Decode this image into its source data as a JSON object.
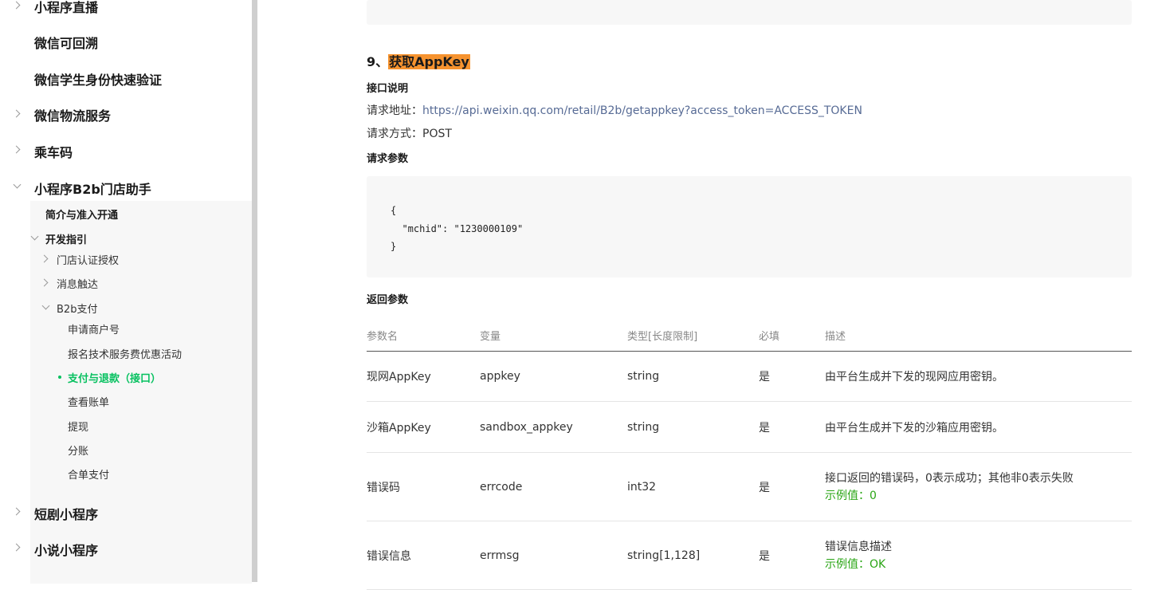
{
  "sidebar": {
    "top_items": [
      {
        "label": "小程序直播",
        "chevron": "right"
      },
      {
        "label": "微信可回溯",
        "chevron": ""
      },
      {
        "label": "微信学生身份快速验证",
        "chevron": ""
      },
      {
        "label": "微信物流服务",
        "chevron": "right"
      },
      {
        "label": "乘车码",
        "chevron": "right"
      },
      {
        "label": "小程序B2b门店助手",
        "chevron": "down"
      }
    ],
    "sub_intro": "简介与准入开通",
    "sub_dev": "开发指引",
    "dev_items": [
      "门店认证授权",
      "消息触达",
      "B2b支付"
    ],
    "pay_items": [
      "申请商户号",
      "报名技术服务费优惠活动",
      "支付与退款（接口）",
      "查看账单",
      "提现",
      "分账",
      "合单支付"
    ],
    "bottom_items": [
      {
        "label": "短剧小程序"
      },
      {
        "label": "小说小程序"
      }
    ],
    "accent_color": "#07c160"
  },
  "main": {
    "section_num": "9、",
    "section_title": "获取AppKey",
    "intro_heading": "接口说明",
    "req_url_label": "请求地址：",
    "req_url": "https://api.weixin.qq.com/retail/B2b/getappkey?access_token=ACCESS_TOKEN",
    "req_method_label": "请求方式：",
    "req_method": "POST",
    "req_params_heading": "请求参数",
    "code_sample": "{\n  \"mchid\": \"1230000109\"\n}",
    "resp_params_heading": "返回参数",
    "table": {
      "headers": [
        "参数名",
        "变量",
        "类型[长度限制]",
        "必填",
        "描述"
      ],
      "rows": [
        {
          "name": "现网AppKey",
          "var": "appkey",
          "type": "string",
          "required": "是",
          "desc": "由平台生成并下发的现网应用密钥。",
          "example": ""
        },
        {
          "name": "沙箱AppKey",
          "var": "sandbox_appkey",
          "type": "string",
          "required": "是",
          "desc": "由平台生成并下发的沙箱应用密钥。",
          "example": ""
        },
        {
          "name": "错误码",
          "var": "errcode",
          "type": "int32",
          "required": "是",
          "desc": "接口返回的错误码，0表示成功；其他非0表示失败",
          "example": "示例值：0"
        },
        {
          "name": "错误信息",
          "var": "errmsg",
          "type": "string[1,128]",
          "required": "是",
          "desc": "错误信息描述",
          "example": "示例值：OK"
        }
      ]
    }
  }
}
